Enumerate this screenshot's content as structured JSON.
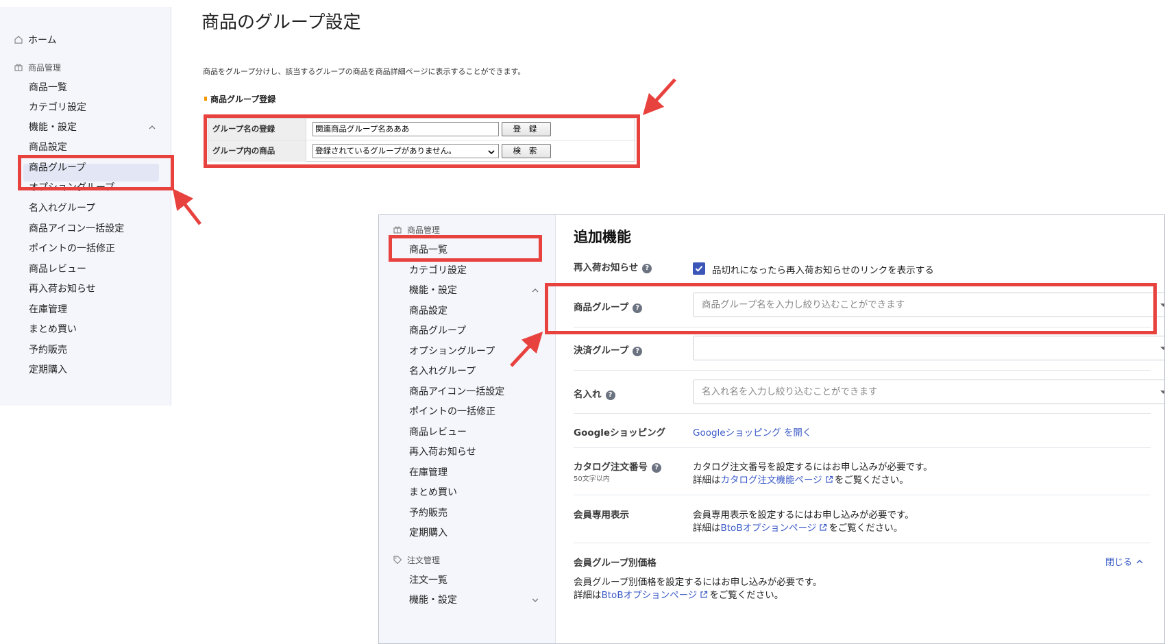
{
  "sidebar1": {
    "home": "ホーム",
    "section": "商品管理",
    "items": [
      "商品一覧",
      "カテゴリ設定",
      "機能・設定",
      "商品設定",
      "商品グループ",
      "オプショングループ",
      "名入れグループ",
      "商品アイコン一括設定",
      "ポイントの一括修正",
      "商品レビュー",
      "再入荷お知らせ",
      "在庫管理",
      "まとめ買い",
      "予約販売",
      "定期購入"
    ]
  },
  "top": {
    "title": "商品のグループ設定",
    "description": "商品をグループ分けし、該当するグループの商品を商品詳細ページに表示することができます。",
    "subhead": "商品グループ登録",
    "row1_label": "グループ名の登録",
    "row1_value": "関連商品グループ名あああ",
    "row1_button": "登 録",
    "row2_label": "グループ内の商品",
    "row2_value": "登録されているグループがありません。",
    "row2_button": "検 索"
  },
  "sidebar2": {
    "section1": "商品管理",
    "items": [
      "商品一覧",
      "カテゴリ設定",
      "機能・設定",
      "商品設定",
      "商品グループ",
      "オプショングループ",
      "名入れグループ",
      "商品アイコン一括設定",
      "ポイントの一括修正",
      "商品レビュー",
      "再入荷お知らせ",
      "在庫管理",
      "まとめ買い",
      "予約販売",
      "定期購入"
    ],
    "section2": "注文管理",
    "items2": [
      "注文一覧",
      "機能・設定"
    ]
  },
  "panel": {
    "title": "追加機能",
    "restock_label": "再入荷お知らせ",
    "restock_check": "品切れになったら再入荷お知らせのリンクを表示する",
    "group_label": "商品グループ",
    "group_placeholder": "商品グループ名を入力し絞り込むことができます",
    "payment_label": "決済グループ",
    "payment_placeholder": "",
    "name_label": "名入れ",
    "name_placeholder": "名入れ名を入力し絞り込むことができます",
    "google_label": "Googleショッピング",
    "google_link": "Googleショッピング を開く",
    "catalog_label": "カタログ注文番号",
    "catalog_sub": "50文字以内",
    "catalog_text1": "カタログ注文番号を設定するにはお申し込みが必要です。",
    "catalog_text2_pre": "詳細は",
    "catalog_text2_link": "カタログ注文機能ページ",
    "catalog_text2_post": "をご覧ください。",
    "member_label": "会員専用表示",
    "member_text1": "会員専用表示を設定するにはお申し込みが必要です。",
    "member_text2_pre": "詳細は",
    "member_text2_link": "BtoBオプションページ",
    "member_text2_post": "をご覧ください。",
    "mgprice_label": "会員グループ別価格",
    "close_link": "閉じる",
    "mgprice_text1": "会員グループ別価格を設定するにはお申し込みが必要です。",
    "mgprice_text2_pre": "詳細は",
    "mgprice_text2_link": "BtoBオプションページ",
    "mgprice_text2_post": "をご覧ください。"
  },
  "colors": {
    "highlight": "#e8423f",
    "accent": "#3c56b8",
    "link": "#3b5bc7",
    "orange_mark": "#f39800"
  },
  "icons": [
    "home-icon",
    "gift-icon",
    "tag-icon",
    "chevron-up-icon",
    "chevron-down-icon",
    "help-icon",
    "checkbox-checked-icon",
    "external-link-icon",
    "arrow-annotation"
  ]
}
